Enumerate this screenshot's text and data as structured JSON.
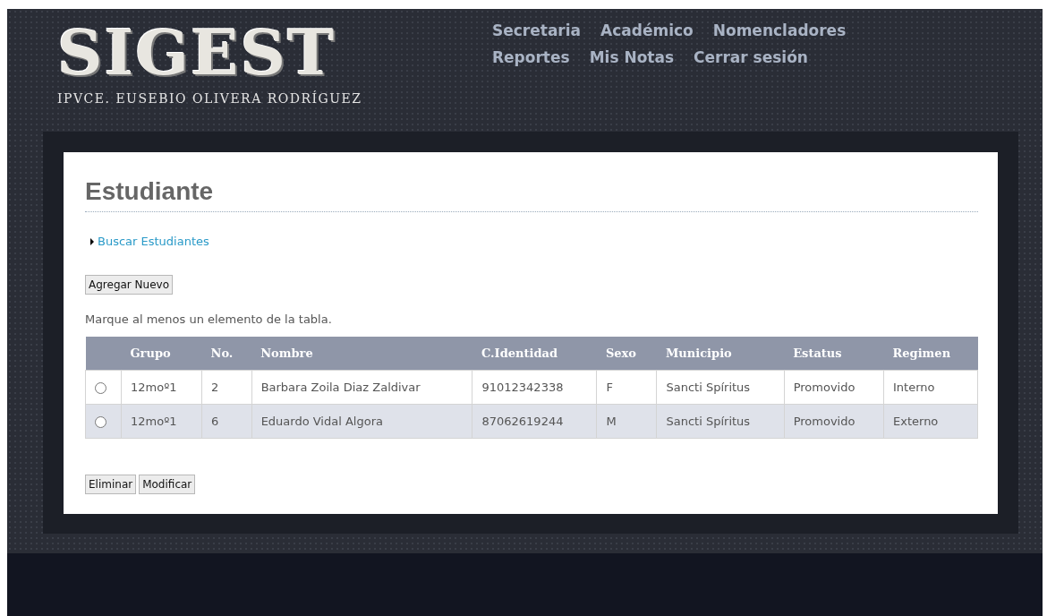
{
  "header": {
    "logo": "SIGEST",
    "subtitle": "IPVCE. EUSEBIO OLIVERA RODRÍGUEZ",
    "nav": [
      [
        "Secretaria",
        "Académico",
        "Nomencladores"
      ],
      [
        "Reportes",
        "Mis Notas",
        "Cerrar sesión"
      ]
    ]
  },
  "page": {
    "title": "Estudiante",
    "search_link": "Buscar Estudiantes",
    "add_button": "Agregar Nuevo",
    "hint": "Marque al menos un elemento de la tabla."
  },
  "table": {
    "columns": [
      "Grupo",
      "No.",
      "Nombre",
      "C.Identidad",
      "Sexo",
      "Municipio",
      "Estatus",
      "Regimen"
    ],
    "rows": [
      {
        "selected": false,
        "cells": [
          "12moº1",
          "2",
          "Barbara Zoila Diaz Zaldivar",
          "91012342338",
          "F",
          "Sancti Spíritus",
          "Promovido",
          "Interno"
        ]
      },
      {
        "selected": false,
        "cells": [
          "12moº1",
          "6",
          "Eduardo Vidal Algora",
          "87062619244",
          "M",
          "Sancti Spíritus",
          "Promovido",
          "Externo"
        ]
      }
    ]
  },
  "actions": [
    "Eliminar",
    "Modificar"
  ]
}
